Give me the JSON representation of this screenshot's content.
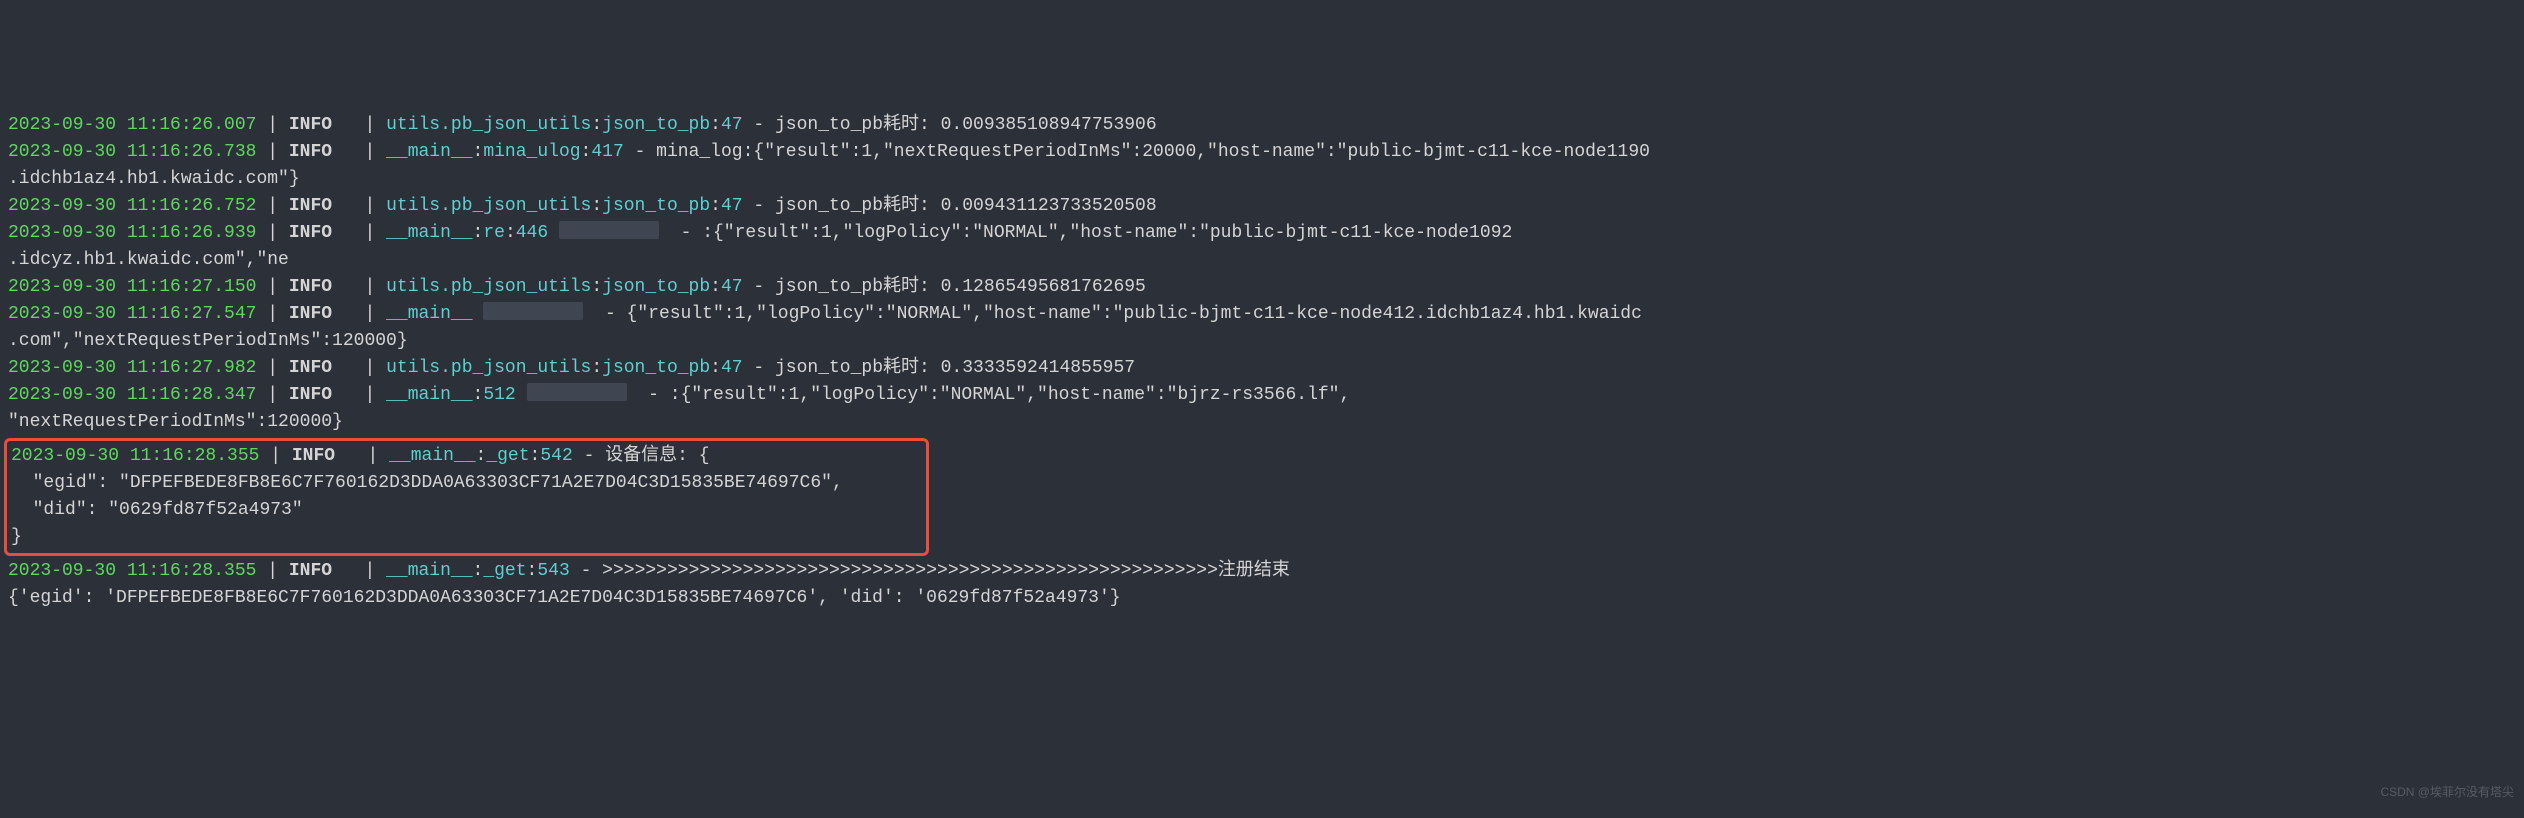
{
  "lines": [
    {
      "ts": "2023-09-30 11:16:26.007",
      "level": "INFO",
      "module": "utils.pb_json_utils",
      "func": "json_to_pb",
      "lineno": "47",
      "msg": "json_to_pb耗时: 0.009385108947753906"
    },
    {
      "ts": "2023-09-30 11:16:26.738",
      "level": "INFO",
      "module": "__main__",
      "func": "mina_ulog",
      "lineno": "417",
      "msg": "mina_log:{\"result\":1,\"nextRequestPeriodInMs\":20000,\"host-name\":\"public-bjmt-c11-kce-node1190",
      "cont": ".idchb1az4.hb1.kwaidc.com\"}"
    },
    {
      "ts": "2023-09-30 11:16:26.752",
      "level": "INFO",
      "module": "utils.pb_json_utils",
      "func": "json_to_pb",
      "lineno": "47",
      "msg": "json_to_pb耗时: 0.009431123733520508"
    },
    {
      "ts": "2023-09-30 11:16:26.939",
      "level": "INFO",
      "module": "__main__",
      "func": "re",
      "lineno": "446",
      "msg": ":{\"result\":1,\"logPolicy\":\"NORMAL\",\"host-name\":\"public-bjmt-c11-kce-node1092",
      "cont": ".idcyz.hb1.kwaidc.com\",\"ne",
      "smudge": true
    },
    {
      "ts": "2023-09-30 11:16:27.150",
      "level": "INFO",
      "module": "utils.pb_json_utils",
      "func": "json_to_pb",
      "lineno": "47",
      "msg": "json_to_pb耗时: 0.12865495681762695"
    },
    {
      "ts": "2023-09-30 11:16:27.547",
      "level": "INFO",
      "module": "__main__",
      "func": "",
      "lineno": "",
      "msg": "{\"result\":1,\"logPolicy\":\"NORMAL\",\"host-name\":\"public-bjmt-c11-kce-node412.idchb1az4.hb1.kwaidc",
      "cont": ".com\",\"nextRequestPeriodInMs\":120000}",
      "smudge": true
    },
    {
      "ts": "2023-09-30 11:16:27.982",
      "level": "INFO",
      "module": "utils.pb_json_utils",
      "func": "json_to_pb",
      "lineno": "47",
      "msg": "json_to_pb耗时: 0.3333592414855957"
    },
    {
      "ts": "2023-09-30 11:16:28.347",
      "level": "INFO",
      "module": "__main__",
      "func": "",
      "lineno": "512",
      "msg": ":{\"result\":1,\"logPolicy\":\"NORMAL\",\"host-name\":\"bjrz-rs3566.lf\",",
      "cont": "\"nextRequestPeriodInMs\":120000}",
      "smudge": true
    }
  ],
  "highlighted": {
    "ts": "2023-09-30 11:16:28.355",
    "level": "INFO",
    "module": "__main__",
    "func": "_get",
    "lineno": "542",
    "msg_intro": "设备信息: {",
    "body1": "  \"egid\": \"DFPEFBEDE8FB8E6C7F760162D3DDA0A63303CF71A2E7D04C3D15835BE74697C6\",",
    "body2": "  \"did\": \"0629fd87f52a4973\"",
    "body3": "}"
  },
  "after": {
    "ts": "2023-09-30 11:16:28.355",
    "level": "INFO",
    "module": "__main__",
    "func": "_get",
    "lineno": "543",
    "msg": ">>>>>>>>>>>>>>>>>>>>>>>>>>>>>>>>>>>>>>>>>>>>>>>>>>>>>>>>>注册结束"
  },
  "final_line": "{'egid': 'DFPEFBEDE8FB8E6C7F760162D3DDA0A63303CF71A2E7D04C3D15835BE74697C6', 'did': '0629fd87f52a4973'}",
  "watermark": "CSDN @埃菲尔没有塔尖",
  "pipe": " | ",
  "dash": " - ",
  "colon": ":"
}
